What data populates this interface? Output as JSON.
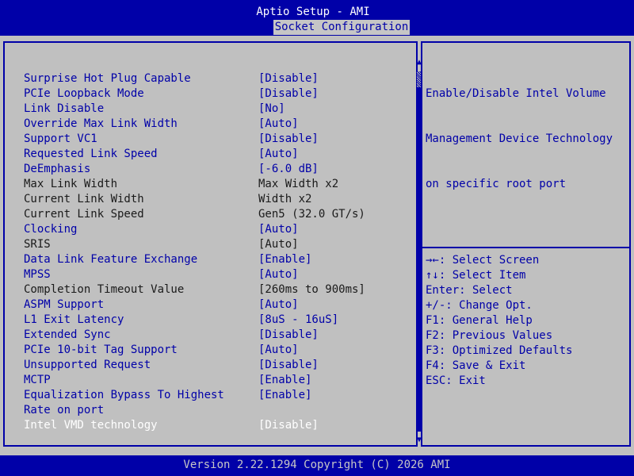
{
  "header": {
    "title": "Aptio Setup - AMI",
    "active_tab": "Socket Configuration"
  },
  "settings": [
    {
      "label": "Surprise Hot Plug Capable",
      "value": "[Disable]",
      "type": "editable"
    },
    {
      "label": "PCIe Loopback Mode",
      "value": "[Disable]",
      "type": "editable"
    },
    {
      "label": "Link Disable",
      "value": "[No]",
      "type": "editable"
    },
    {
      "label": "Override Max Link Width",
      "value": "[Auto]",
      "type": "editable"
    },
    {
      "label": "Support VC1",
      "value": "[Disable]",
      "type": "editable"
    },
    {
      "label": "Requested Link Speed",
      "value": "[Auto]",
      "type": "editable"
    },
    {
      "label": "DeEmphasis",
      "value": "[-6.0 dB]",
      "type": "editable"
    },
    {
      "label": "Max Link Width",
      "value": "Max Width x2",
      "type": "static"
    },
    {
      "label": "Current Link Width",
      "value": "Width x2",
      "type": "static"
    },
    {
      "label": "Current Link Speed",
      "value": "Gen5 (32.0 GT/s)",
      "type": "static"
    },
    {
      "label": "Clocking",
      "value": "[Auto]",
      "type": "editable"
    },
    {
      "label": "SRIS",
      "value": "[Auto]",
      "type": "static"
    },
    {
      "label": "Data Link Feature Exchange",
      "value": "[Enable]",
      "type": "editable"
    },
    {
      "label": "MPSS",
      "value": "[Auto]",
      "type": "editable"
    },
    {
      "label": "Completion Timeout Value",
      "value": "[260ms to 900ms]",
      "type": "static"
    },
    {
      "label": "ASPM Support",
      "value": "[Auto]",
      "type": "editable"
    },
    {
      "label": "L1 Exit Latency",
      "value": "[8uS - 16uS]",
      "type": "editable"
    },
    {
      "label": "Extended Sync",
      "value": "[Disable]",
      "type": "editable"
    },
    {
      "label": "PCIe 10-bit Tag Support",
      "value": "[Auto]",
      "type": "editable"
    },
    {
      "label": "Unsupported Request",
      "value": "[Disable]",
      "type": "editable"
    },
    {
      "label": "MCTP",
      "value": "[Enable]",
      "type": "editable"
    },
    {
      "label": "Equalization Bypass To Highest",
      "value": "[Enable]",
      "type": "editable"
    },
    {
      "label": "Rate on port",
      "value": "",
      "type": "editable"
    },
    {
      "label": "Intel VMD technology",
      "value": "[Disable]",
      "type": "selected"
    }
  ],
  "help": {
    "lines": [
      "Enable/Disable Intel Volume",
      "Management Device Technology",
      "on specific root port"
    ]
  },
  "key_hints": [
    "→←: Select Screen",
    "↑↓: Select Item",
    "Enter: Select",
    "+/-: Change Opt.",
    "F1: General Help",
    "F2: Previous Values",
    "F3: Optimized Defaults",
    "F4: Save & Exit",
    "ESC: Exit"
  ],
  "scrollbar": {
    "up_icon": "▲",
    "down_icon": "▼",
    "position": 0.0
  },
  "footer": {
    "text": "Version 2.22.1294 Copyright (C) 2026 AMI"
  },
  "colors": {
    "bios_blue": "#0000a8",
    "panel_gray": "#c0c0c0",
    "selected_text": "#ffffff"
  }
}
